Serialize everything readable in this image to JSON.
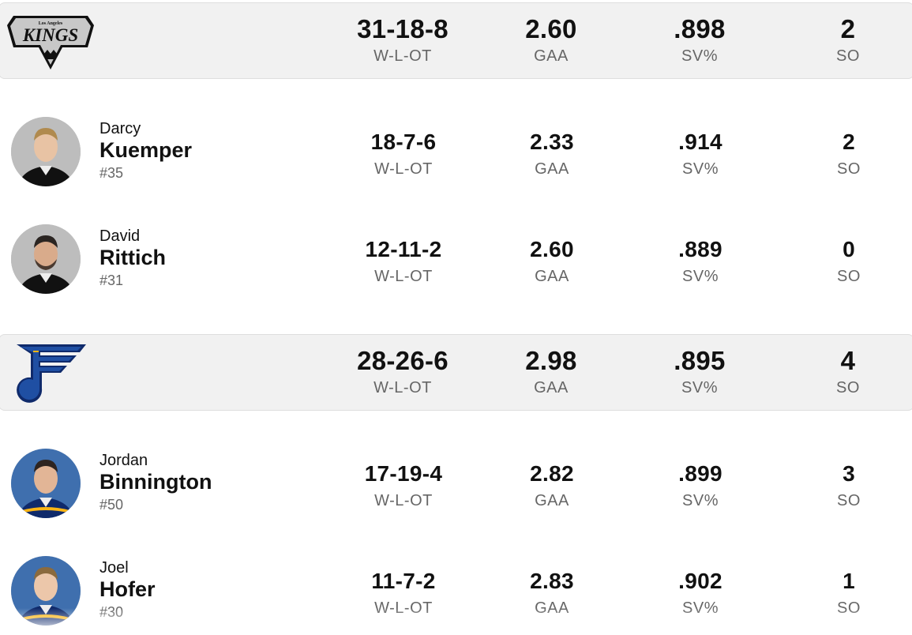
{
  "teams": [
    {
      "logo_icon": "la-kings-logo",
      "logo_text_small": "Los Angeles",
      "logo_text": "KINGS",
      "record": "31-18-8",
      "record_label": "W-L-OT",
      "gaa": "2.60",
      "gaa_label": "GAA",
      "sv": ".898",
      "sv_label": "SV%",
      "so": "2",
      "so_label": "SO",
      "players": [
        {
          "first": "Darcy",
          "last": "Kuemper",
          "number": "#35",
          "jersey_color": "#111111",
          "record": "18-7-6",
          "record_label": "W-L-OT",
          "gaa": "2.33",
          "gaa_label": "GAA",
          "sv": ".914",
          "sv_label": "SV%",
          "so": "2",
          "so_label": "SO"
        },
        {
          "first": "David",
          "last": "Rittich",
          "number": "#31",
          "jersey_color": "#111111",
          "record": "12-11-2",
          "record_label": "W-L-OT",
          "gaa": "2.60",
          "gaa_label": "GAA",
          "sv": ".889",
          "sv_label": "SV%",
          "so": "0",
          "so_label": "SO"
        }
      ]
    },
    {
      "logo_icon": "st-louis-blues-note-logo",
      "record": "28-26-6",
      "record_label": "W-L-OT",
      "gaa": "2.98",
      "gaa_label": "GAA",
      "sv": ".895",
      "sv_label": "SV%",
      "so": "4",
      "so_label": "SO",
      "players": [
        {
          "first": "Jordan",
          "last": "Binnington",
          "number": "#50",
          "jersey_color": "#0f2a6b",
          "record": "17-19-4",
          "record_label": "W-L-OT",
          "gaa": "2.82",
          "gaa_label": "GAA",
          "sv": ".899",
          "sv_label": "SV%",
          "so": "3",
          "so_label": "SO"
        },
        {
          "first": "Joel",
          "last": "Hofer",
          "number": "#30",
          "jersey_color": "#0f2a6b",
          "record": "11-7-2",
          "record_label": "W-L-OT",
          "gaa": "2.83",
          "gaa_label": "GAA",
          "sv": ".902",
          "sv_label": "SV%",
          "so": "1",
          "so_label": "SO"
        }
      ]
    }
  ],
  "colors": {
    "team_row_bg": "#f1f1f1",
    "label_gray": "#666666",
    "blues_blue": "#1f4fa3",
    "blues_gold": "#fcb514"
  }
}
